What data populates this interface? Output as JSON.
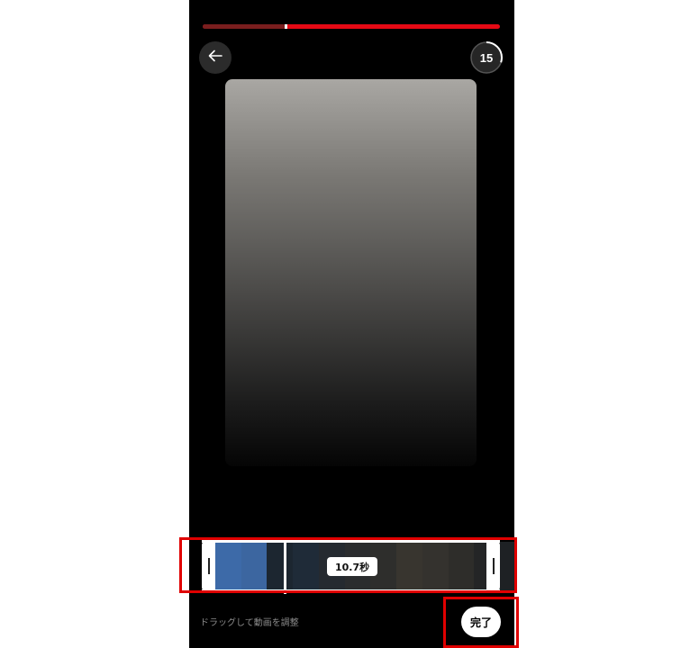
{
  "progress": {
    "value": 0.28
  },
  "timer": {
    "label": "15",
    "ring_fraction": 0.3
  },
  "icons": {
    "back": "arrow-left-icon"
  },
  "timeline": {
    "frames": [
      "#3d6aa8",
      "#3c66a0",
      "#1c2630",
      "#1f2b38",
      "#252a30",
      "#2a2c2e",
      "#2e2e2c",
      "#38352f",
      "#34322e",
      "#2e2d2a",
      "#242526"
    ],
    "duration_label": "10.7秒"
  },
  "hint": "ドラッグして動画を調整",
  "done_label": "完了",
  "colors": {
    "accent": "#e50914",
    "annotation": "#e00000"
  }
}
